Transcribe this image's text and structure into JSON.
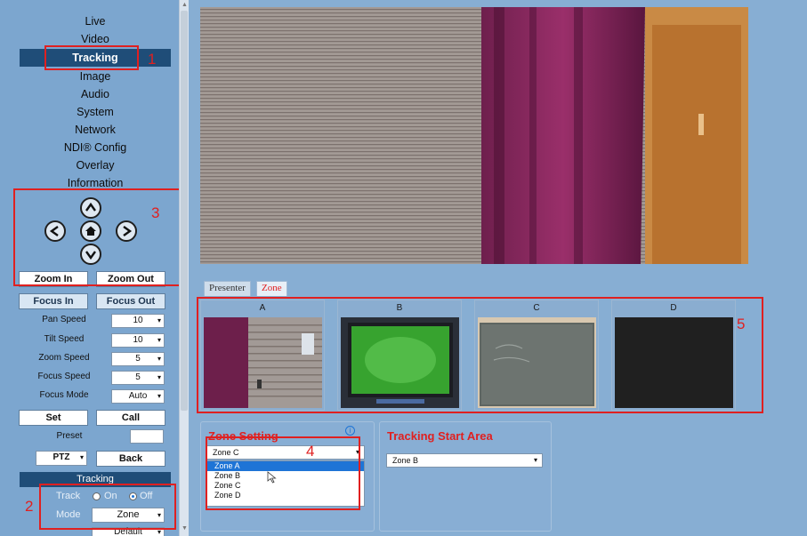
{
  "nav": {
    "items": [
      {
        "label": "Live"
      },
      {
        "label": "Video"
      },
      {
        "label": "Tracking"
      },
      {
        "label": "Image"
      },
      {
        "label": "Audio"
      },
      {
        "label": "System"
      },
      {
        "label": "Network"
      },
      {
        "label": "NDI® Config"
      },
      {
        "label": "Overlay"
      },
      {
        "label": "Information"
      }
    ],
    "active": "Tracking"
  },
  "ptz": {
    "zoom_in": "Zoom In",
    "zoom_out": "Zoom Out",
    "focus_in": "Focus In",
    "focus_out": "Focus Out",
    "params": [
      {
        "label": "Pan Speed",
        "value": "10"
      },
      {
        "label": "Tilt Speed",
        "value": "10"
      },
      {
        "label": "Zoom Speed",
        "value": "5"
      },
      {
        "label": "Focus Speed",
        "value": "5"
      },
      {
        "label": "Focus Mode",
        "value": "Auto"
      }
    ],
    "set": "Set",
    "call": "Call",
    "preset_label": "Preset",
    "preset_value": "",
    "ptz_select": "PTZ",
    "back": "Back"
  },
  "tracking_section": {
    "header": "Tracking",
    "track_label": "Track",
    "on": "On",
    "off": "Off",
    "track_value": "Off",
    "mode_label": "Mode",
    "mode_value": "Zone",
    "partial_value": "Default"
  },
  "annotations": {
    "n1": "1",
    "n2": "2",
    "n3": "3",
    "n4": "4",
    "n5": "5"
  },
  "tabs": [
    {
      "label": "Presenter"
    },
    {
      "label": "Zone"
    }
  ],
  "active_tab": "Zone",
  "zones": [
    {
      "label": "A"
    },
    {
      "label": "B"
    },
    {
      "label": "C"
    },
    {
      "label": "D"
    }
  ],
  "zone_setting": {
    "title": "Zone Setting",
    "info_icon": "info-circle-icon",
    "selected": "Zone C",
    "options": [
      "Zone A",
      "Zone B",
      "Zone C",
      "Zone D"
    ],
    "highlighted": "Zone A"
  },
  "tracking_start": {
    "title": "Tracking Start Area",
    "selected": "Zone B"
  },
  "colors": {
    "sidebar_bg": "#7ca6cf",
    "main_bg": "#87aed3",
    "active_nav": "#1f4d78",
    "annotation_red": "#e02020",
    "dropdown_highlight": "#1e74d6"
  }
}
